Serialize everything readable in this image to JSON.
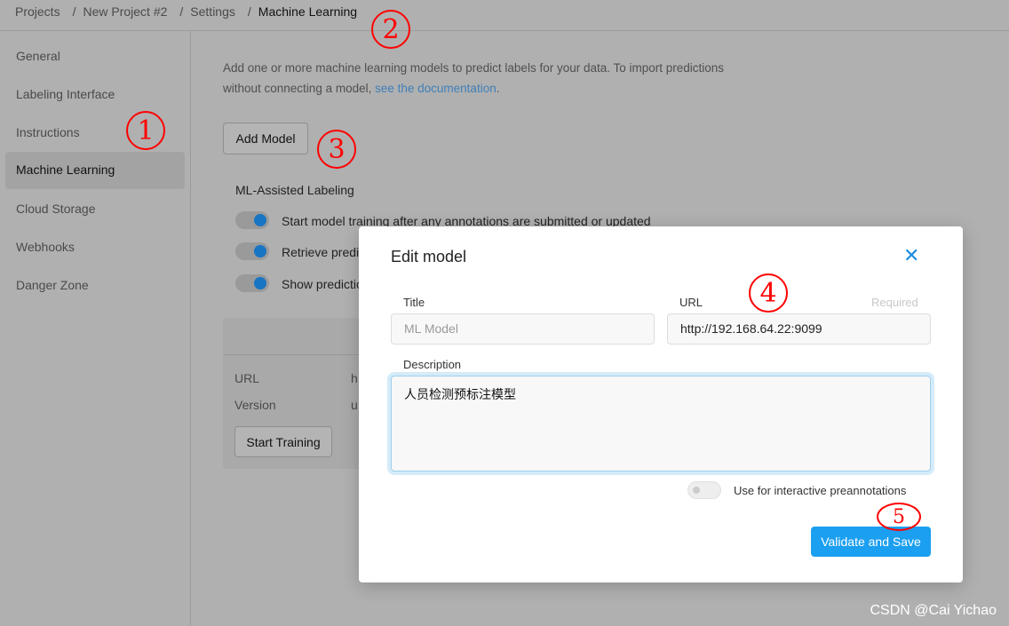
{
  "breadcrumb": [
    "Projects",
    "New Project #2",
    "Settings",
    "Machine Learning"
  ],
  "sidebar": {
    "items": [
      {
        "label": "General"
      },
      {
        "label": "Labeling Interface"
      },
      {
        "label": "Instructions"
      },
      {
        "label": "Machine Learning",
        "active": true
      },
      {
        "label": "Cloud Storage"
      },
      {
        "label": "Webhooks"
      },
      {
        "label": "Danger Zone"
      }
    ]
  },
  "main": {
    "desc_line1": "Add one or more machine learning models to predict labels for your data. To import predictions",
    "desc_line2": "without connecting a model, ",
    "doc_link": "see the documentation",
    "desc_end": ".",
    "add_model": "Add Model",
    "ml_heading": "ML-Assisted Labeling",
    "toggles": [
      {
        "label": "Start model training after any annotations are submitted or updated",
        "on": true
      },
      {
        "label": "Retrieve predic",
        "on": true
      },
      {
        "label": "Show predictio",
        "on": true
      }
    ],
    "card": {
      "url_label": "URL",
      "url_value": "h",
      "version_label": "Version",
      "version_value": "u",
      "start_training": "Start Training"
    }
  },
  "modal": {
    "title": "Edit model",
    "title_label": "Title",
    "title_placeholder": "ML Model",
    "url_label": "URL",
    "required": "Required",
    "url_value": "http://192.168.64.22:9099",
    "description_label": "Description",
    "description_value": "人员检测预标注模型",
    "interactive_label": "Use for interactive preannotations",
    "interactive_on": false,
    "save": "Validate and Save"
  },
  "annotations": [
    "1",
    "2",
    "3",
    "4",
    "5"
  ],
  "watermark": "CSDN @Cai Yichao",
  "colors": {
    "accent": "#1b9ff0",
    "annotation": "#ff0000"
  }
}
